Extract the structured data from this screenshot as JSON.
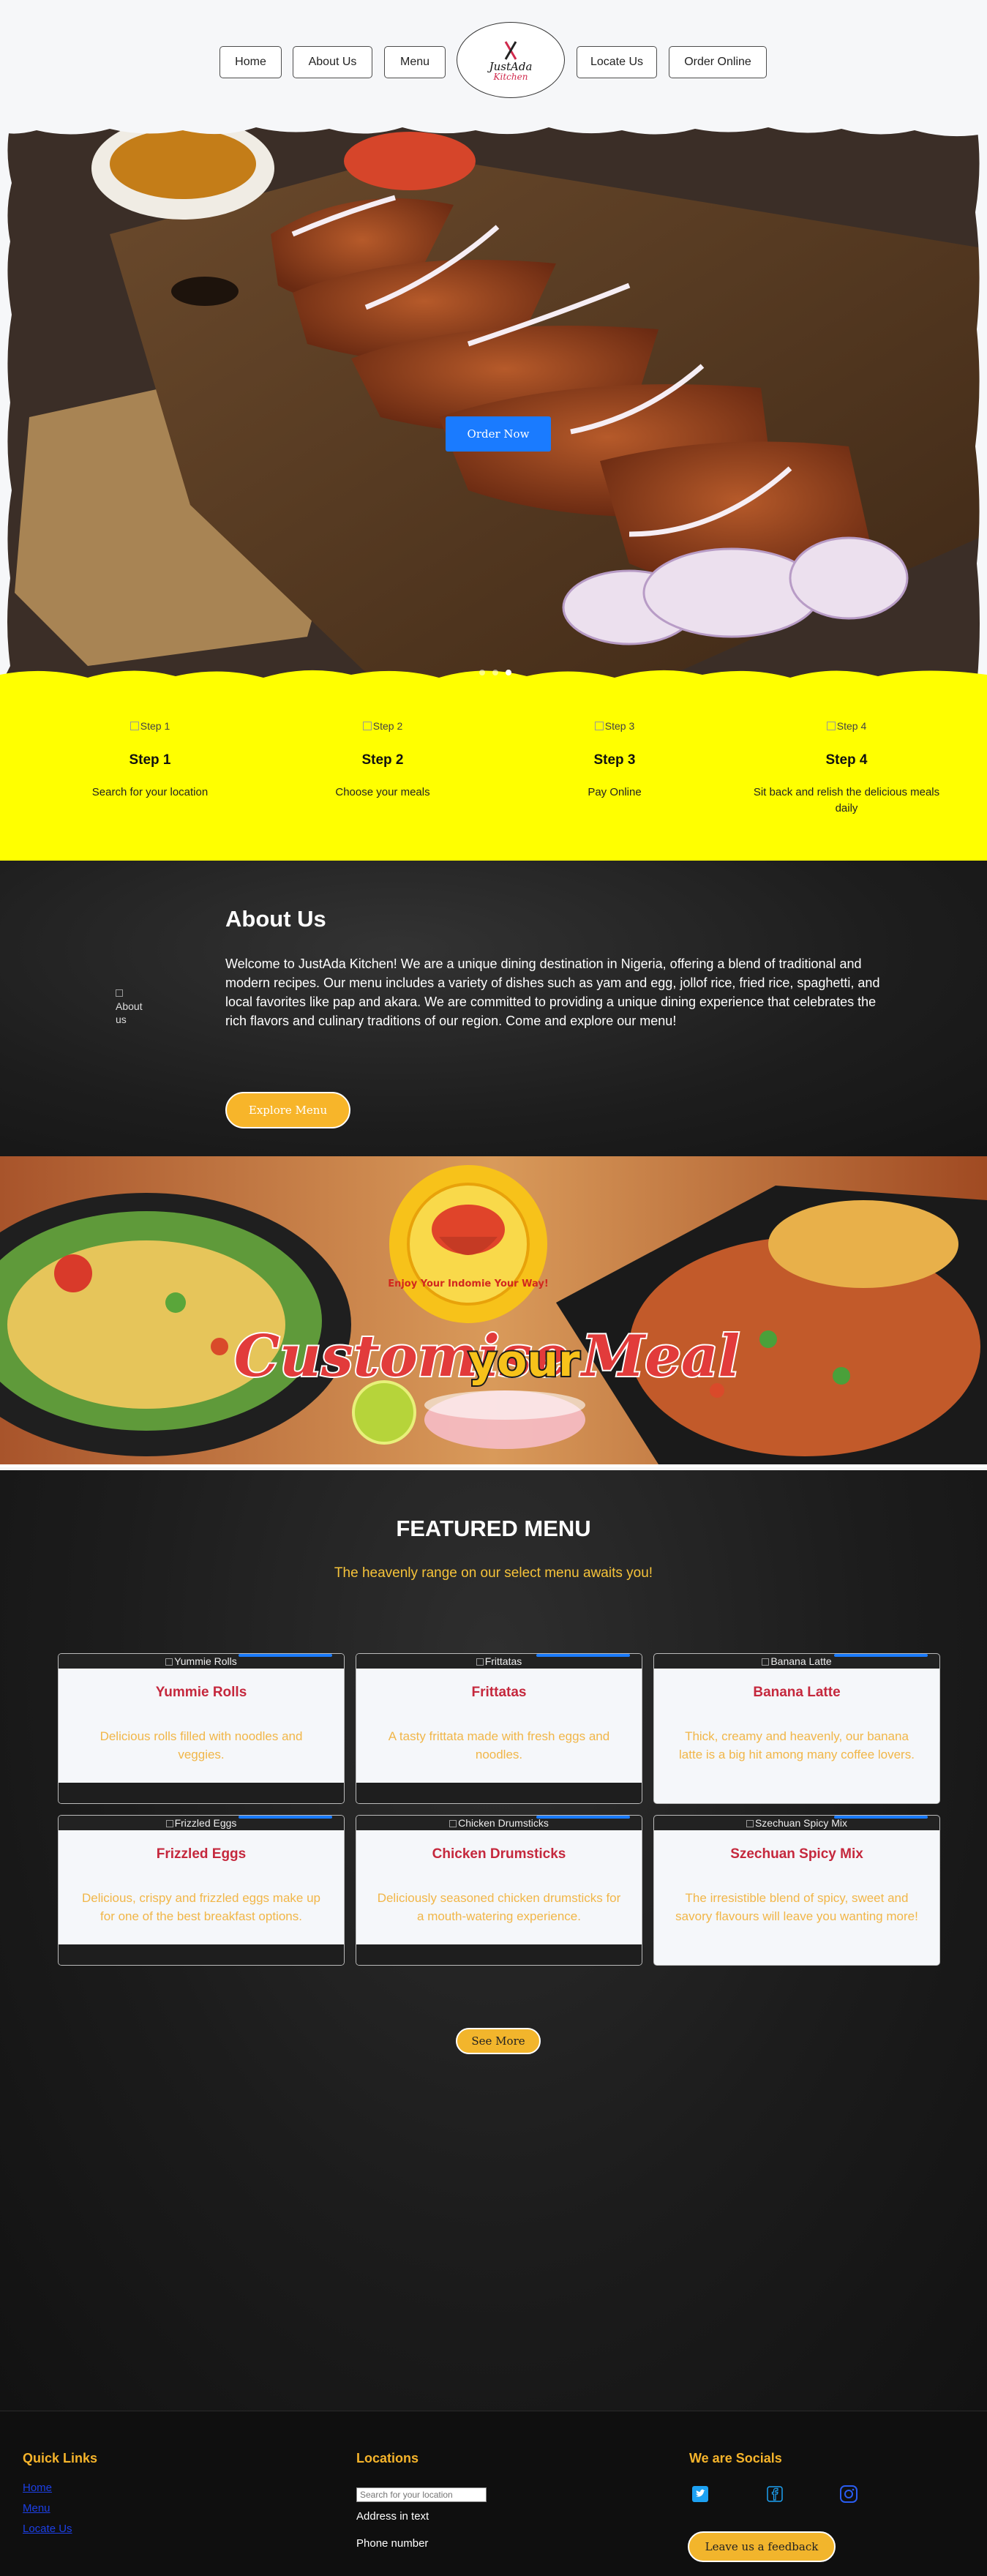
{
  "nav": {
    "items": [
      "Home",
      "About Us",
      "Menu",
      "Locate Us",
      "Order Online"
    ],
    "logo": {
      "text": "JustAda",
      "sub": "Kitchen"
    }
  },
  "hero": {
    "cta": "Order Now",
    "slides_count": 3,
    "active_slide": 2
  },
  "steps": [
    {
      "img_alt": "Step 1",
      "title": "Step 1",
      "desc": "Search for your location"
    },
    {
      "img_alt": "Step 2",
      "title": "Step 2",
      "desc": "Choose your meals"
    },
    {
      "img_alt": "Step 3",
      "title": "Step 3",
      "desc": "Pay Online"
    },
    {
      "img_alt": "Step 4",
      "title": "Step 4",
      "desc": "Sit back and relish the delicious meals daily"
    }
  ],
  "about": {
    "img_alt": "About us",
    "title": "About Us",
    "text": "Welcome to JustAda Kitchen! We are a unique dining destination in Nigeria, offering a blend of traditional and modern recipes. Our menu includes a variety of dishes such as yam and egg, jollof rice, fried rice, spaghetti, and local favorites like pap and akara. We are committed to providing a unique dining experience that celebrates the rich flavors and culinary traditions of our region. Come and explore our menu!",
    "button": "Explore Menu"
  },
  "banner": {
    "headline_1": "Customise",
    "headline_2": "your",
    "headline_3": "Meal",
    "badge_text": "Enjoy Your Indomie Your Way!"
  },
  "featured": {
    "title": "FEATURED MENU",
    "subtitle": "The heavenly range on our select menu awaits you!",
    "items": [
      {
        "img_alt": "Yummie Rolls",
        "name": "Yummie Rolls",
        "desc": "Delicious rolls filled with noodles and veggies."
      },
      {
        "img_alt": "Frittatas",
        "name": "Frittatas",
        "desc": "A tasty frittata made with fresh eggs and noodles."
      },
      {
        "img_alt": "Banana Latte",
        "name": "Banana Latte",
        "desc": "Thick, creamy and heavenly, our banana latte is a big hit among many coffee lovers."
      },
      {
        "img_alt": "Frizzled Eggs",
        "name": "Frizzled Eggs",
        "desc": "Delicious, crispy and frizzled eggs make up for one of the best breakfast options."
      },
      {
        "img_alt": "Chicken Drumsticks",
        "name": "Chicken Drumsticks",
        "desc": "Deliciously seasoned chicken drumsticks for a mouth-watering experience."
      },
      {
        "img_alt": "Szechuan Spicy Mix",
        "name": "Szechuan Spicy Mix",
        "desc": "The irresistible blend of spicy, sweet and savory flavours will leave you wanting more!"
      }
    ],
    "see_more": "See More"
  },
  "footer": {
    "quick_links": {
      "title": "Quick Links",
      "links": [
        "Home",
        "Menu",
        "Locate Us"
      ]
    },
    "locations": {
      "title": "Locations",
      "search_placeholder": "Search for your location",
      "address": "Address in text",
      "phone": "Phone number"
    },
    "socials": {
      "title": "We are Socials",
      "icons": [
        "twitter-icon",
        "facebook-icon",
        "instagram-icon"
      ],
      "button": "Leave us a feedback"
    }
  },
  "colors": {
    "accent_blue": "#1a7bff",
    "yellow": "#ffff00",
    "gold": "#f2b52c",
    "menu_red": "#c5283d",
    "desc_orange": "#f1b648"
  }
}
